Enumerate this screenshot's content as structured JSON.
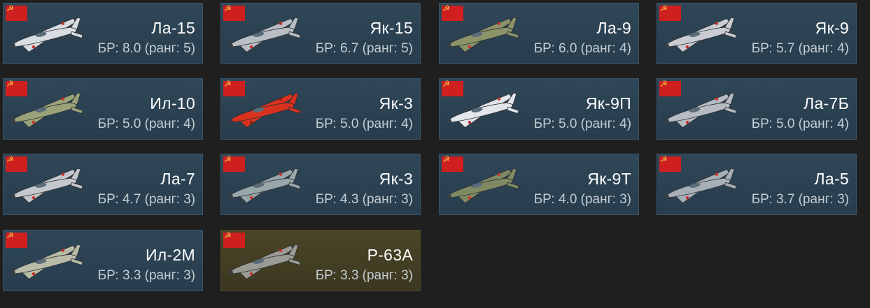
{
  "cards": [
    {
      "name": "Ла-15",
      "br": "БР: 8.0 (ранг: 5)",
      "camo": "#d8dde2",
      "accent": "#c8302a",
      "premium": false
    },
    {
      "name": "Як-15",
      "br": "БР: 6.7 (ранг: 5)",
      "camo": "#b9bec4",
      "accent": "#c8302a",
      "premium": false
    },
    {
      "name": "Ла-9",
      "br": "БР: 6.0 (ранг: 4)",
      "camo": "#8b9468",
      "accent": "#c8302a",
      "premium": false
    },
    {
      "name": "Як-9",
      "br": "БР: 5.7 (ранг: 4)",
      "camo": "#c9ccd0",
      "accent": "#c8302a",
      "premium": false
    },
    {
      "name": "Ил-10",
      "br": "БР: 5.0 (ранг: 4)",
      "camo": "#9aa27a",
      "accent": "#c8302a",
      "premium": false
    },
    {
      "name": "Як-3",
      "br": "БР: 5.0 (ранг: 4)",
      "camo": "#d8321f",
      "accent": "#8a1a12",
      "premium": false
    },
    {
      "name": "Як-9П",
      "br": "БР: 5.0 (ранг: 4)",
      "camo": "#e2e6ea",
      "accent": "#c8302a",
      "premium": false
    },
    {
      "name": "Ла-7Б",
      "br": "БР: 5.0 (ранг: 4)",
      "camo": "#b7bcc2",
      "accent": "#c8302a",
      "premium": false
    },
    {
      "name": "Ла-7",
      "br": "БР: 4.7 (ранг: 3)",
      "camo": "#c4c8cd",
      "accent": "#c8302a",
      "premium": false
    },
    {
      "name": "Як-3",
      "br": "БР: 4.3 (ранг: 3)",
      "camo": "#98a7a9",
      "accent": "#c8302a",
      "premium": false
    },
    {
      "name": "Як-9Т",
      "br": "БР: 4.0 (ранг: 3)",
      "camo": "#7f8a63",
      "accent": "#c8302a",
      "premium": false
    },
    {
      "name": "Ла-5",
      "br": "БР: 3.7 (ранг: 3)",
      "camo": "#a9afb6",
      "accent": "#c8302a",
      "premium": false
    },
    {
      "name": "Ил-2М",
      "br": "БР: 3.3 (ранг: 3)",
      "camo": "#b9bca6",
      "accent": "#c8302a",
      "premium": false
    },
    {
      "name": "P-63A",
      "br": "БР: 3.3 (ранг: 3)",
      "camo": "#9a9c94",
      "accent": "#c8302a",
      "premium": true
    }
  ]
}
